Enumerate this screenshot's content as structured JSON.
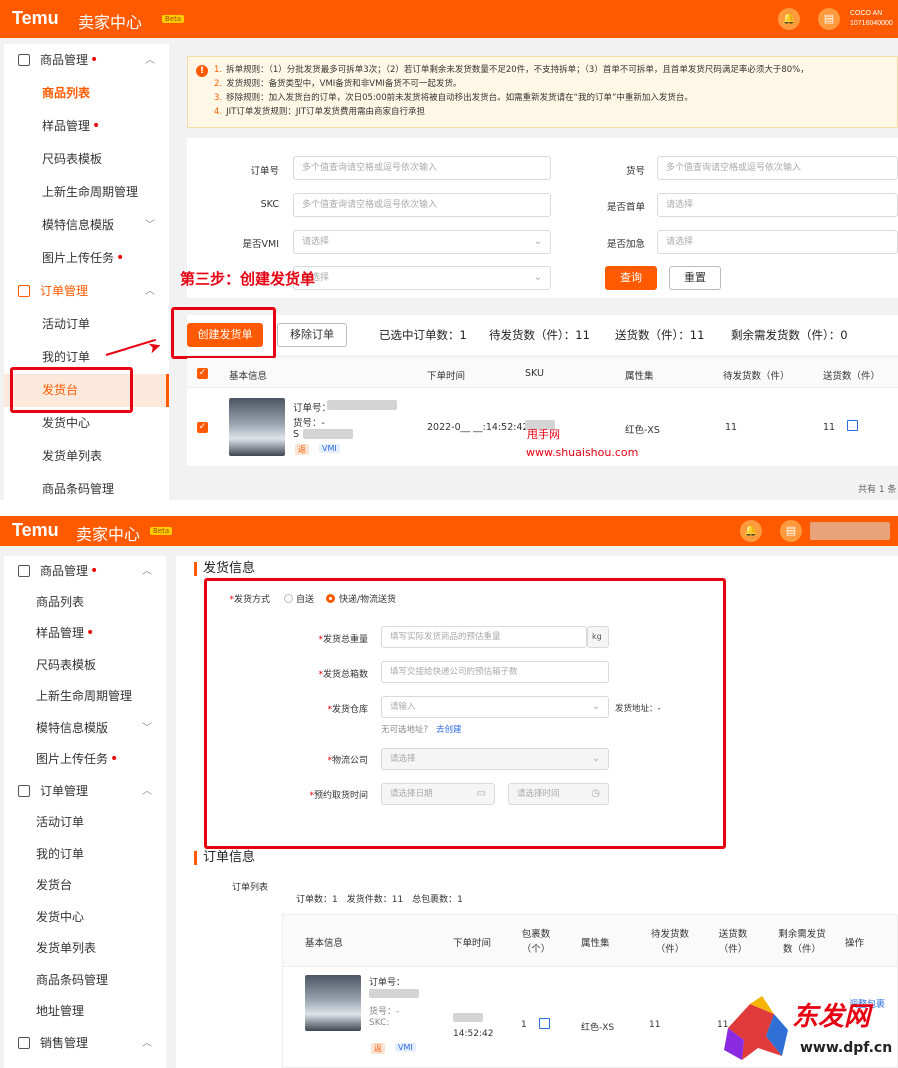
{
  "brand": {
    "logo": "Temu",
    "center": "卖家中心",
    "beta": "Beta",
    "account_line1": "COCO AN",
    "account_line2": "10716040000"
  },
  "icons": [
    "bell-icon",
    "avatar-icon",
    "warning-icon",
    "edit-icon",
    "calendar-icon",
    "clock-icon",
    "chevron-down-icon",
    "chevron-up-icon",
    "checkbox-icon"
  ],
  "colors": {
    "accent": "#ff5a00",
    "annotation": "#e60012",
    "link": "#2d6cdf"
  },
  "panel1": {
    "sidebar": {
      "goods_mgmt": "商品管理",
      "goods_list": "商品列表",
      "sample_mgmt": "样品管理",
      "size_template": "尺码表模板",
      "lifecycle": "上新生命周期管理",
      "model_template": "模特信息模版",
      "image_upload": "图片上传任务",
      "order_mgmt": "订单管理",
      "active_orders": "活动订单",
      "my_orders": "我的订单",
      "shipping_desk": "发货台",
      "shipping_center": "发货中心",
      "shipping_list": "发货单列表",
      "barcode_mgmt": "商品条码管理"
    },
    "notice": [
      {
        "num": "1.",
        "text": "拆单规则：（1）分批发货最多可拆单3次；（2）若订单剩余未发货数量不足20件，不支持拆单；（3）首单不可拆单，且首单发货尺码满足率必须大于80%，"
      },
      {
        "num": "2.",
        "text": "发货规则：备货类型中，VMI备货和非VMI备货不可一起发货。"
      },
      {
        "num": "3.",
        "text": "移除规则：加入发货台的订单，次日05:00前未发货将被自动移出发货台。如需重新发货请在“我的订单”中重新加入发货台。"
      },
      {
        "num": "4.",
        "text": "JIT订单发货规则：JIT订单发货费用需由商家自行承担"
      }
    ],
    "filters": {
      "order_no_label": "订单号",
      "order_no_placeholder": "多个值查询请空格或逗号依次输入",
      "skc_label": "SKC",
      "skc_placeholder": "多个值查询请空格或逗号依次输入",
      "vmi_label": "是否VMI",
      "vmi_placeholder": "请选择",
      "goods_no_label": "货号",
      "goods_no_placeholder": "多个值查询请空格或逗号依次输入",
      "first_order_label": "是否首单",
      "first_order_placeholder": "请选择",
      "urgent_label": "是否加急",
      "urgent_placeholder": "请选择",
      "extra_select_placeholder": "请选择",
      "search_button": "查询",
      "reset_button": "重置"
    },
    "annotation_step": "第三步：创建发货单",
    "toolbar": {
      "create_button": "创建发货单",
      "remove_button": "移除订单",
      "selected_orders": "已选中订单数：1",
      "pending_qty": "待发货数（件）：11",
      "ship_qty": "送货数（件）：11",
      "remaining_qty": "剩余需发货数（件）：0"
    },
    "table": {
      "headers": [
        "基本信息",
        "下单时间",
        "SKU",
        "属性集",
        "待发货数（件）",
        "送货数（件）"
      ],
      "row": {
        "order_no_label": "订单号：",
        "goods_no_label": "货号：-",
        "skc_label": "S",
        "tag_return": "返",
        "tag_vmi": "VMI",
        "order_time": "2022-0__ __:14:52:42",
        "attr": "红色-XS",
        "pending": "11",
        "ship": "11"
      },
      "footer": "共有 1 条"
    },
    "watermark_name": "甩手网",
    "watermark_url": "www.shuaishou.com"
  },
  "panel2": {
    "sidebar": {
      "goods_mgmt": "商品管理",
      "goods_list": "商品列表",
      "sample_mgmt": "样品管理",
      "size_template": "尺码表模板",
      "lifecycle": "上新生命周期管理",
      "model_template": "模特信息模版",
      "image_upload": "图片上传任务",
      "order_mgmt": "订单管理",
      "active_orders": "活动订单",
      "my_orders": "我的订单",
      "shipping_desk": "发货台",
      "shipping_center": "发货中心",
      "shipping_list": "发货单列表",
      "barcode_mgmt": "商品条码管理",
      "address_mgmt": "地址管理",
      "sales_mgmt": "销售管理"
    },
    "shipping_info": {
      "title": "发货信息",
      "method_label": "发货方式",
      "method_self": "自送",
      "method_express": "快递/物流送货",
      "weight_label": "发货总重量",
      "weight_placeholder": "填写实际发货商品的预估重量",
      "weight_unit": "kg",
      "boxes_label": "发货总箱数",
      "boxes_placeholder": "填写交接给快递公司的预估箱子数",
      "warehouse_label": "发货仓库",
      "warehouse_placeholder": "请输入",
      "address_label": "发货地址：-",
      "no_address": "无可选地址？",
      "create_link": "去创建",
      "carrier_label": "物流公司",
      "carrier_placeholder": "请选择",
      "pickup_label": "预约取货时间",
      "date_placeholder": "请选择日期",
      "time_placeholder": "请选择时间"
    },
    "order_info": {
      "title": "订单信息",
      "list_label": "订单列表",
      "summary": "订单数：1　发货件数：11　总包裹数：1",
      "headers": [
        "基本信息",
        "下单时间",
        "包裹数（个）",
        "属性集",
        "待发货数（件）",
        "送货数（件）",
        "剩余需发货数（件）",
        "操作"
      ],
      "row": {
        "order_no_label": "订单号：",
        "goods_no_label": "货号：-",
        "skc_label": "SKC:",
        "tag_return": "返",
        "tag_vmi": "VMI",
        "order_time": "14:52:42",
        "packages": "1",
        "attr": "红色-XS",
        "pending": "11",
        "ship": "11",
        "action": "调整包裹"
      }
    },
    "badge_name": "东发网",
    "badge_url": "www.dpf.cn"
  }
}
